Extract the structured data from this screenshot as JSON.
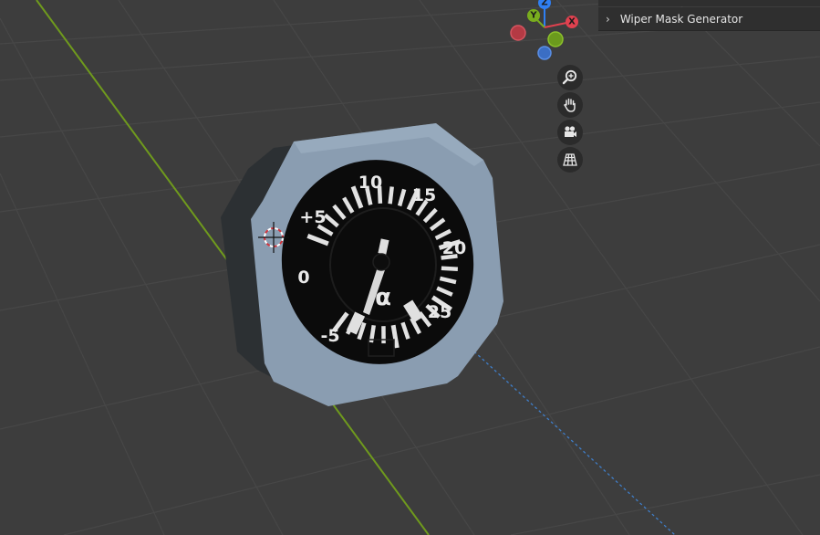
{
  "app": {
    "name": "3D Viewport"
  },
  "sidebar": {
    "panels": [
      {
        "label": "Wiper Mask Generator",
        "collapsed": true
      }
    ]
  },
  "navigation_gizmo": {
    "axes": [
      {
        "label": "Z",
        "color": "#2f7ff3"
      },
      {
        "label": "Y",
        "color": "#79ad1e"
      },
      {
        "label": "X",
        "color": "#e0414f"
      }
    ],
    "negative_axis_colors": [
      "#b43a44",
      "#6b9a1d",
      "#3b6ec4"
    ]
  },
  "view_tools": [
    {
      "name": "zoom",
      "icon": "zoom-icon"
    },
    {
      "name": "pan",
      "icon": "hand-icon"
    },
    {
      "name": "camera",
      "icon": "camera-icon"
    },
    {
      "name": "perspective",
      "icon": "grid-icon"
    }
  ],
  "gauge": {
    "scale_labels": [
      "-5",
      "0",
      "+5",
      "10",
      "15",
      "20",
      "25"
    ],
    "symbol": "α",
    "bezel_color": "#8a9db1",
    "face_color": "#0b0b0b"
  },
  "colors": {
    "background": "#3d3d3d",
    "grid": "#4a4a4a",
    "y_axis_line": "#6f9a1d",
    "cursor_red": "#d2343c"
  }
}
